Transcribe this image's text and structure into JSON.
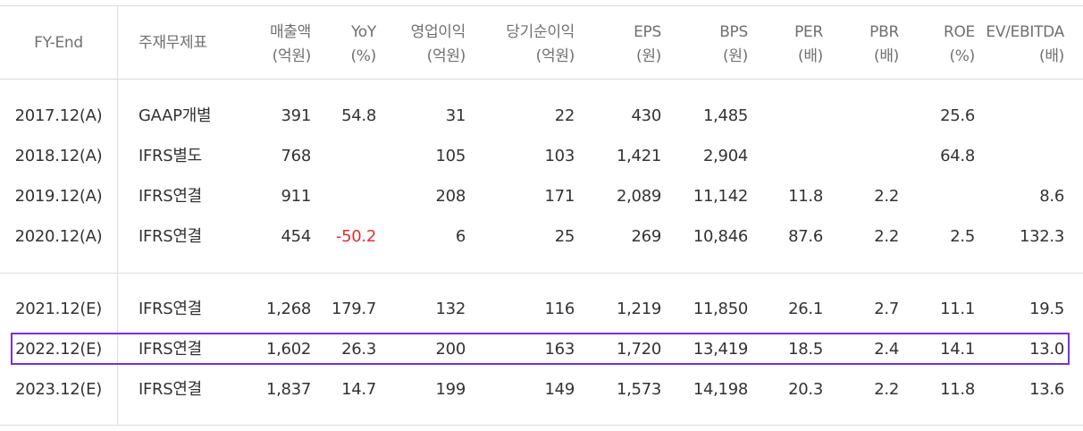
{
  "header": {
    "fy_end": "FY-End",
    "statement": "주재무제표",
    "revenue": [
      "매출액",
      "(억원)"
    ],
    "yoy": [
      "YoY",
      "(%)"
    ],
    "op_income": [
      "영업이익",
      "(억원)"
    ],
    "net_income": [
      "당기순이익",
      "(억원)"
    ],
    "eps": [
      "EPS",
      "(원)"
    ],
    "bps": [
      "BPS",
      "(원)"
    ],
    "per": [
      "PER",
      "(배)"
    ],
    "pbr": [
      "PBR",
      "(배)"
    ],
    "roe": [
      "ROE",
      "(%)"
    ],
    "ev_ebitda": [
      "EV/EBITDA",
      "(배)"
    ]
  },
  "rows": [
    {
      "fy": "2017.12(A)",
      "basis": "GAAP개별",
      "revenue": "391",
      "yoy": "54.8",
      "op": "31",
      "net": "22",
      "eps": "430",
      "bps": "1,485",
      "per": "",
      "pbr": "",
      "roe": "25.6",
      "ev": ""
    },
    {
      "fy": "2018.12(A)",
      "basis": "IFRS별도",
      "revenue": "768",
      "yoy": "",
      "op": "105",
      "net": "103",
      "eps": "1,421",
      "bps": "2,904",
      "per": "",
      "pbr": "",
      "roe": "64.8",
      "ev": ""
    },
    {
      "fy": "2019.12(A)",
      "basis": "IFRS연결",
      "revenue": "911",
      "yoy": "",
      "op": "208",
      "net": "171",
      "eps": "2,089",
      "bps": "11,142",
      "per": "11.8",
      "pbr": "2.2",
      "roe": "",
      "ev": "8.6"
    },
    {
      "fy": "2020.12(A)",
      "basis": "IFRS연결",
      "revenue": "454",
      "yoy": "-50.2",
      "op": "6",
      "net": "25",
      "eps": "269",
      "bps": "10,846",
      "per": "87.6",
      "pbr": "2.2",
      "roe": "2.5",
      "ev": "132.3"
    },
    {
      "fy": "2021.12(E)",
      "basis": "IFRS연결",
      "revenue": "1,268",
      "yoy": "179.7",
      "op": "132",
      "net": "116",
      "eps": "1,219",
      "bps": "11,850",
      "per": "26.1",
      "pbr": "2.7",
      "roe": "11.1",
      "ev": "19.5"
    },
    {
      "fy": "2022.12(E)",
      "basis": "IFRS연결",
      "revenue": "1,602",
      "yoy": "26.3",
      "op": "200",
      "net": "163",
      "eps": "1,720",
      "bps": "13,419",
      "per": "18.5",
      "pbr": "2.4",
      "roe": "14.1",
      "ev": "13.0"
    },
    {
      "fy": "2023.12(E)",
      "basis": "IFRS연결",
      "revenue": "1,837",
      "yoy": "14.7",
      "op": "199",
      "net": "149",
      "eps": "1,573",
      "bps": "14,198",
      "per": "20.3",
      "pbr": "2.2",
      "roe": "11.8",
      "ev": "13.6"
    }
  ],
  "colors": {
    "negative": "#e0302e",
    "highlight_border": "#7b2fe0",
    "grid": "#dcdcdc"
  }
}
